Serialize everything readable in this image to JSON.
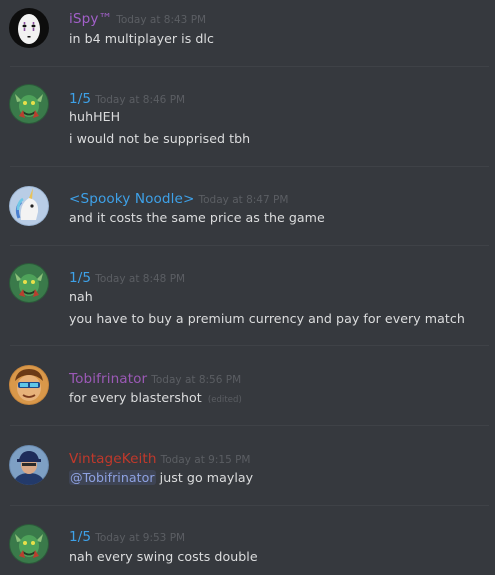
{
  "colors": {
    "background": "#36393e",
    "text": "#dcddde",
    "timestamp": "#5b5e63",
    "ispy": "#a260c9",
    "onefive": "#3ea1e8",
    "spooky": "#3ea1e8",
    "tobi": "#9b59b6",
    "vintage": "#c0392b",
    "mention": "#8ea1e1"
  },
  "messages": [
    {
      "author": "iSpy™",
      "timestamp": "Today at 8:43 PM",
      "avatar_icon": "no-face-mask-icon",
      "lines": [
        "in b4 multiplayer is dlc"
      ]
    },
    {
      "author": "1/5",
      "timestamp": "Today at 8:46 PM",
      "avatar_icon": "green-dragon-icon",
      "lines": [
        "huhHEH",
        "i would not be supprised tbh"
      ]
    },
    {
      "author": "<Spooky Noodle>",
      "timestamp": "Today at 8:47 PM",
      "avatar_icon": "unicorn-icon",
      "lines": [
        "and it costs the same price as the game"
      ]
    },
    {
      "author": "1/5",
      "timestamp": "Today at 8:48 PM",
      "avatar_icon": "green-dragon-icon",
      "lines": [
        "nah",
        "you have to buy a premium currency and pay for every match"
      ]
    },
    {
      "author": "Tobifrinator",
      "timestamp": "Today at 8:56 PM",
      "avatar_icon": "sunglasses-face-icon",
      "lines": [
        "for every blastershot"
      ],
      "edited": "(edited)"
    },
    {
      "author": "VintageKeith",
      "timestamp": "Today at 9:15 PM",
      "avatar_icon": "person-cap-icon",
      "mention": "@Tobifrinator",
      "mention_rest": " just go maylay"
    },
    {
      "author": "1/5",
      "timestamp": "Today at 9:53 PM",
      "avatar_icon": "green-dragon-icon",
      "lines": [
        "nah every swing costs double"
      ]
    }
  ]
}
